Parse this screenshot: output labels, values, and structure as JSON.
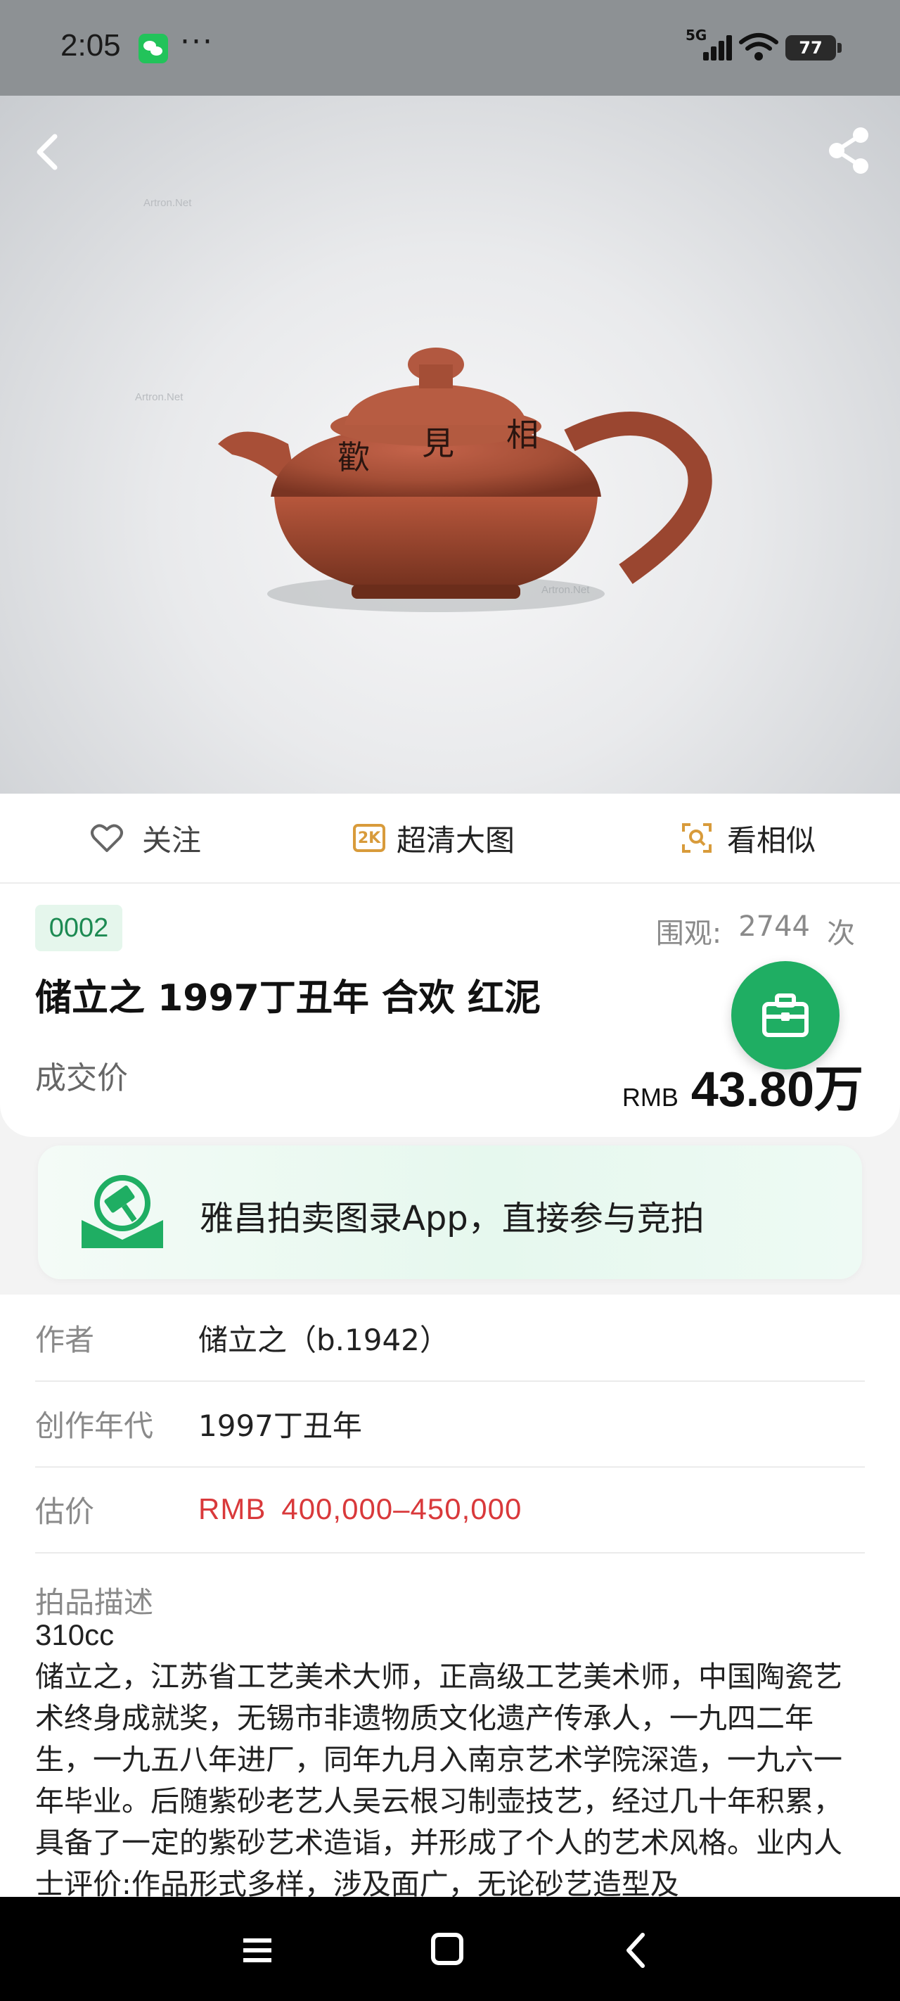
{
  "status_bar": {
    "time": "2:05",
    "more": "···",
    "network": "5G",
    "battery": "77",
    "icons": [
      "wechat-icon",
      "signal-icon",
      "wifi-icon",
      "battery-icon"
    ]
  },
  "hero": {
    "watermark": "Artron.Net",
    "icons": [
      "back-icon",
      "share-icon"
    ]
  },
  "actions": {
    "follow": "关注",
    "hd_badge": "2K",
    "hd": "超清大图",
    "similar": "看相似"
  },
  "lot": {
    "number": "0002",
    "views_label": "围观:",
    "views": "2744",
    "views_unit": "次",
    "title": "储立之 1997丁丑年 合欢 红泥",
    "price_label": "成交价",
    "currency": "RMB",
    "price": "43.80万"
  },
  "promo": {
    "text": "雅昌拍卖图录App，直接参与竞拍"
  },
  "details": {
    "rows": [
      {
        "label": "作者",
        "value": "储立之（b.1942）"
      },
      {
        "label": "创作年代",
        "value": "1997丁丑年"
      }
    ],
    "estimate_label": "估价",
    "estimate_currency": "RMB",
    "estimate_value": "400,000–450,000",
    "description_label": "拍品描述",
    "capacity": "310cc",
    "description": "储立之，江苏省工艺美术大师，正高级工艺美术师，中国陶瓷艺术终身成就奖，无锡市非遗物质文化遗产传承人，一九四二年生，一九五八年进厂，同年九月入南京艺术学院深造，一九六一年毕业。后随紫砂老艺人吴云根习制壶技艺，经过几十年积累，具备了一定的紫砂艺术造诣，并形成了个人的艺术风格。业内人士评价:作品形式多样，涉及面广，无论砂艺造型及"
  },
  "colors": {
    "accent_green": "#1fae63",
    "estimate_red": "#d9393b",
    "hd_orange": "#d89b3b"
  }
}
